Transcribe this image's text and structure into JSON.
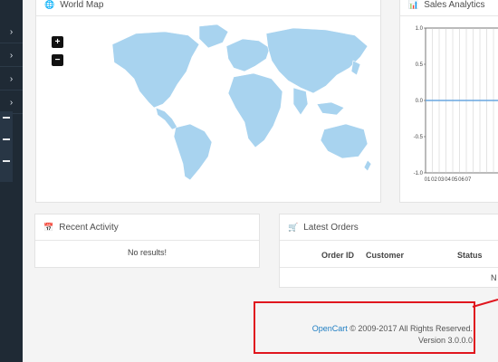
{
  "sidebar": {
    "items": [
      {
        "icon": "›"
      },
      {
        "icon": "›"
      },
      {
        "icon": "›"
      },
      {
        "icon": "›"
      }
    ]
  },
  "world_map": {
    "title": "World Map",
    "zoom_in": "+",
    "zoom_out": "−"
  },
  "sales_analytics": {
    "title": "Sales Analytics",
    "chart_data": {
      "type": "line",
      "y_ticks": [
        "1.0",
        "0.5",
        "0.0",
        "-0.5",
        "-1.0"
      ],
      "x": [
        "01",
        "02",
        "03",
        "04",
        "05",
        "06",
        "07"
      ],
      "series": [
        {
          "values": [
            0,
            0,
            0,
            0,
            0,
            0,
            0
          ]
        }
      ],
      "ylim": [
        -1.0,
        1.0
      ]
    }
  },
  "recent_activity": {
    "title": "Recent Activity",
    "empty_text": "No results!"
  },
  "latest_orders": {
    "title": "Latest Orders",
    "columns": [
      "Order ID",
      "Customer",
      "Status"
    ],
    "partial_text": "N"
  },
  "footer": {
    "brand": "OpenCart",
    "copyright": "© 2009-2017 All Rights Reserved.",
    "version": "Version 3.0.0.0"
  }
}
